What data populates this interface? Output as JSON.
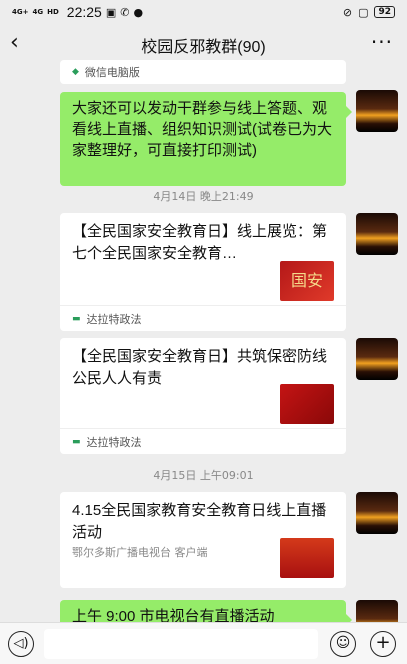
{
  "status_bar": {
    "signal_1": "4G+",
    "signal_2": "4G",
    "hd": "HD",
    "time": "22:25",
    "battery": "92"
  },
  "nav": {
    "back_icon": "chevron-left-icon",
    "title": "校园反邪教群(90)",
    "more_icon": "more-icon"
  },
  "messages": {
    "top_card_source": "微信电脑版",
    "msg1": "大家还可以发动干群参与线上答题、观看线上直播、组织知识测试(试卷已为大家整理好，可直接打印测试)",
    "time1": "4月14日 晚上21:49",
    "card1_title": "【全民国家安全教育日】线上展览：第七个全民国家安全教育…",
    "card1_source": "达拉特政法",
    "card2_title": "【全民国家安全教育日】共筑保密防线 公民人人有责",
    "card2_source": "达拉特政法",
    "time2": "4月15日 上午09:01",
    "card3_title": "4.15全民国家教育安全教育日线上直播活动",
    "card3_desc": "鄂尔多斯广播电视台 客户端",
    "msg2": "上午 9:00 市电视台有直播活动"
  },
  "input_bar": {
    "voice_icon": "voice-icon",
    "emoji_icon": "emoji-icon",
    "plus_icon": "plus-icon"
  },
  "colors": {
    "bubble_green": "#95ec69",
    "background": "#ededed",
    "card_white": "#ffffff"
  }
}
